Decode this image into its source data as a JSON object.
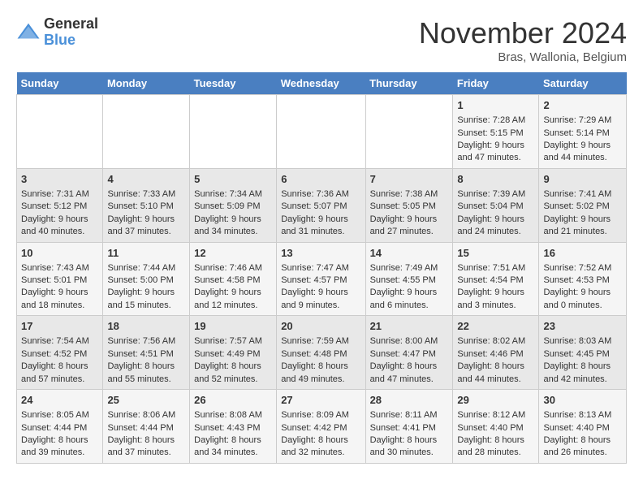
{
  "header": {
    "logo_general": "General",
    "logo_blue": "Blue",
    "month_title": "November 2024",
    "location": "Bras, Wallonia, Belgium"
  },
  "days_of_week": [
    "Sunday",
    "Monday",
    "Tuesday",
    "Wednesday",
    "Thursday",
    "Friday",
    "Saturday"
  ],
  "weeks": [
    [
      {
        "day": "",
        "info": ""
      },
      {
        "day": "",
        "info": ""
      },
      {
        "day": "",
        "info": ""
      },
      {
        "day": "",
        "info": ""
      },
      {
        "day": "",
        "info": ""
      },
      {
        "day": "1",
        "info": "Sunrise: 7:28 AM\nSunset: 5:15 PM\nDaylight: 9 hours and 47 minutes."
      },
      {
        "day": "2",
        "info": "Sunrise: 7:29 AM\nSunset: 5:14 PM\nDaylight: 9 hours and 44 minutes."
      }
    ],
    [
      {
        "day": "3",
        "info": "Sunrise: 7:31 AM\nSunset: 5:12 PM\nDaylight: 9 hours and 40 minutes."
      },
      {
        "day": "4",
        "info": "Sunrise: 7:33 AM\nSunset: 5:10 PM\nDaylight: 9 hours and 37 minutes."
      },
      {
        "day": "5",
        "info": "Sunrise: 7:34 AM\nSunset: 5:09 PM\nDaylight: 9 hours and 34 minutes."
      },
      {
        "day": "6",
        "info": "Sunrise: 7:36 AM\nSunset: 5:07 PM\nDaylight: 9 hours and 31 minutes."
      },
      {
        "day": "7",
        "info": "Sunrise: 7:38 AM\nSunset: 5:05 PM\nDaylight: 9 hours and 27 minutes."
      },
      {
        "day": "8",
        "info": "Sunrise: 7:39 AM\nSunset: 5:04 PM\nDaylight: 9 hours and 24 minutes."
      },
      {
        "day": "9",
        "info": "Sunrise: 7:41 AM\nSunset: 5:02 PM\nDaylight: 9 hours and 21 minutes."
      }
    ],
    [
      {
        "day": "10",
        "info": "Sunrise: 7:43 AM\nSunset: 5:01 PM\nDaylight: 9 hours and 18 minutes."
      },
      {
        "day": "11",
        "info": "Sunrise: 7:44 AM\nSunset: 5:00 PM\nDaylight: 9 hours and 15 minutes."
      },
      {
        "day": "12",
        "info": "Sunrise: 7:46 AM\nSunset: 4:58 PM\nDaylight: 9 hours and 12 minutes."
      },
      {
        "day": "13",
        "info": "Sunrise: 7:47 AM\nSunset: 4:57 PM\nDaylight: 9 hours and 9 minutes."
      },
      {
        "day": "14",
        "info": "Sunrise: 7:49 AM\nSunset: 4:55 PM\nDaylight: 9 hours and 6 minutes."
      },
      {
        "day": "15",
        "info": "Sunrise: 7:51 AM\nSunset: 4:54 PM\nDaylight: 9 hours and 3 minutes."
      },
      {
        "day": "16",
        "info": "Sunrise: 7:52 AM\nSunset: 4:53 PM\nDaylight: 9 hours and 0 minutes."
      }
    ],
    [
      {
        "day": "17",
        "info": "Sunrise: 7:54 AM\nSunset: 4:52 PM\nDaylight: 8 hours and 57 minutes."
      },
      {
        "day": "18",
        "info": "Sunrise: 7:56 AM\nSunset: 4:51 PM\nDaylight: 8 hours and 55 minutes."
      },
      {
        "day": "19",
        "info": "Sunrise: 7:57 AM\nSunset: 4:49 PM\nDaylight: 8 hours and 52 minutes."
      },
      {
        "day": "20",
        "info": "Sunrise: 7:59 AM\nSunset: 4:48 PM\nDaylight: 8 hours and 49 minutes."
      },
      {
        "day": "21",
        "info": "Sunrise: 8:00 AM\nSunset: 4:47 PM\nDaylight: 8 hours and 47 minutes."
      },
      {
        "day": "22",
        "info": "Sunrise: 8:02 AM\nSunset: 4:46 PM\nDaylight: 8 hours and 44 minutes."
      },
      {
        "day": "23",
        "info": "Sunrise: 8:03 AM\nSunset: 4:45 PM\nDaylight: 8 hours and 42 minutes."
      }
    ],
    [
      {
        "day": "24",
        "info": "Sunrise: 8:05 AM\nSunset: 4:44 PM\nDaylight: 8 hours and 39 minutes."
      },
      {
        "day": "25",
        "info": "Sunrise: 8:06 AM\nSunset: 4:44 PM\nDaylight: 8 hours and 37 minutes."
      },
      {
        "day": "26",
        "info": "Sunrise: 8:08 AM\nSunset: 4:43 PM\nDaylight: 8 hours and 34 minutes."
      },
      {
        "day": "27",
        "info": "Sunrise: 8:09 AM\nSunset: 4:42 PM\nDaylight: 8 hours and 32 minutes."
      },
      {
        "day": "28",
        "info": "Sunrise: 8:11 AM\nSunset: 4:41 PM\nDaylight: 8 hours and 30 minutes."
      },
      {
        "day": "29",
        "info": "Sunrise: 8:12 AM\nSunset: 4:40 PM\nDaylight: 8 hours and 28 minutes."
      },
      {
        "day": "30",
        "info": "Sunrise: 8:13 AM\nSunset: 4:40 PM\nDaylight: 8 hours and 26 minutes."
      }
    ]
  ]
}
